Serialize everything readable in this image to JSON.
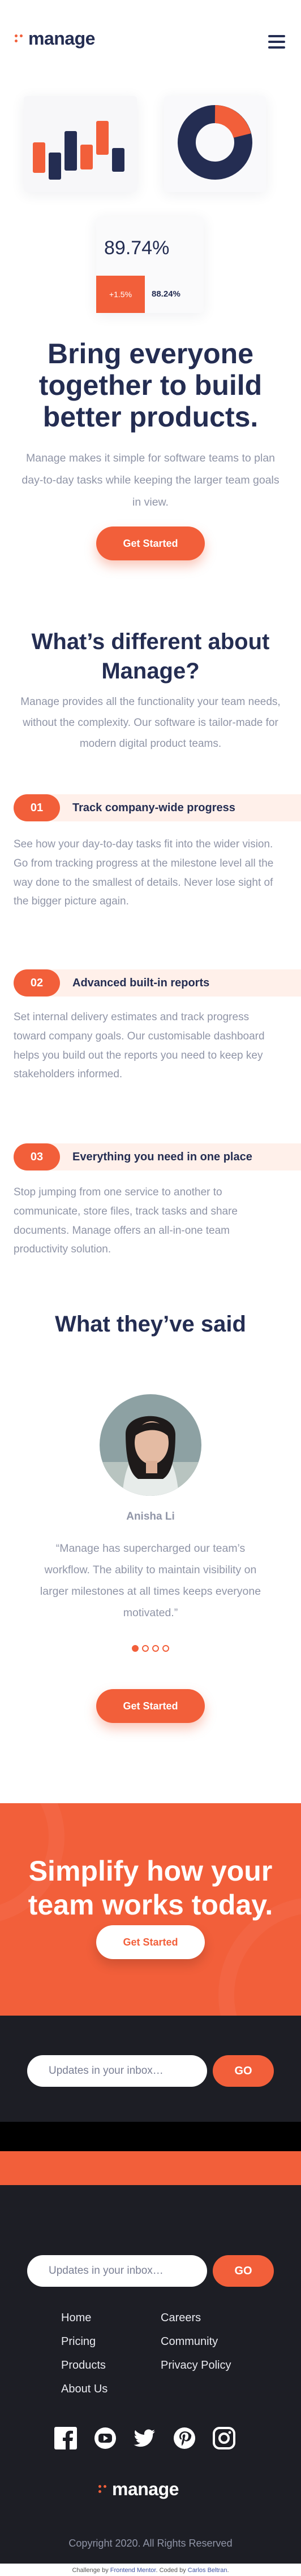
{
  "header": {
    "logo_text": "manage",
    "menu_icon": "hamburger-menu-icon"
  },
  "hero": {
    "stat_value": "89.74%",
    "stat_delta": "+1.5%",
    "stat_secondary": "88.24%",
    "title": "Bring everyone together to build better products.",
    "description": "Manage makes it simple for software teams to plan day-to-day tasks while keeping the larger team goals in view.",
    "cta_label": "Get Started"
  },
  "differences": {
    "title": "What’s different about Manage?",
    "description": "Manage provides all the functionality your team needs, without the complexity. Our software is tailor-made for modern digital product teams.",
    "features": [
      {
        "number": "01",
        "title": "Track company-wide progress",
        "body": "See how your day-to-day tasks fit into the wider vision. Go from tracking progress at the milestone level all the way done to the smallest of details. Never lose sight of the bigger picture again."
      },
      {
        "number": "02",
        "title": "Advanced built-in reports",
        "body": "Set internal delivery estimates and track progress toward company goals. Our customisable dashboard helps you build out the reports you need to keep key stakeholders informed."
      },
      {
        "number": "03",
        "title": "Everything you need in one place",
        "body": "Stop jumping from one service to another to communicate, store files, track tasks and share documents. Manage offers an all-in-one team productivity solution."
      }
    ]
  },
  "testimonials": {
    "title": "What they’ve said",
    "name": "Anisha Li",
    "quote": "“Manage has supercharged our team’s workflow. The ability to maintain visibility on larger milestones at all times keeps everyone motivated.”",
    "dots": 4,
    "active_dot": 0,
    "cta_label": "Get Started"
  },
  "cta_banner": {
    "title": "Simplify how your team works today.",
    "cta_label": "Get Started"
  },
  "newsletter": {
    "placeholder": "Updates in your inbox…",
    "button_label": "GO"
  },
  "footer": {
    "links_left": [
      "Home",
      "Pricing",
      "Products",
      "About Us"
    ],
    "links_right": [
      "Careers",
      "Community",
      "Privacy Policy"
    ],
    "social_icons": [
      "facebook-icon",
      "youtube-icon",
      "twitter-icon",
      "pinterest-icon",
      "instagram-icon"
    ],
    "logo_text": "manage",
    "copyright": "Copyright 2020. All Rights Reserved",
    "attribution_prefix": "Challenge by ",
    "attribution_fm": "Frontend Mentor",
    "attribution_mid": ". Coded by ",
    "attribution_author": "Carlos Beltran",
    "attribution_suffix": "."
  },
  "colors": {
    "accent": "#f25f3a",
    "navy": "#242d52",
    "dark_bg": "#1d1e25",
    "soft_orange": "#fff0ea"
  }
}
